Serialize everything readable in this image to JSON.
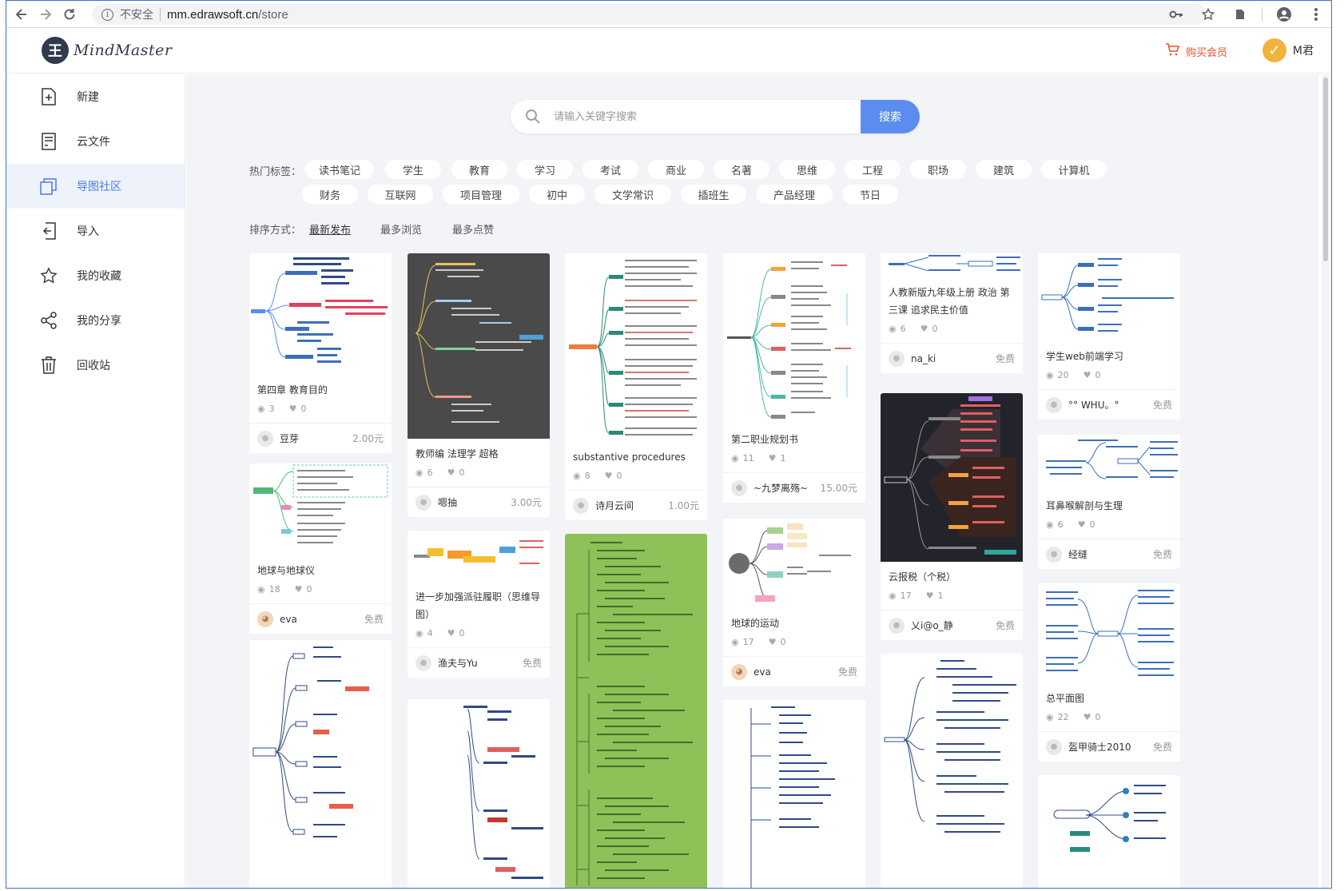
{
  "browser": {
    "security_label": "不安全",
    "url_host": "mm.edrawsoft.cn",
    "url_path": "/store"
  },
  "app": {
    "logo_letter": "王",
    "logo_text": "MindMaster",
    "buy_label": "购买会员",
    "user_name": "M君"
  },
  "sidebar": {
    "items": [
      {
        "label": "新建",
        "icon": "new-file-icon"
      },
      {
        "label": "云文件",
        "icon": "cloud-file-icon"
      },
      {
        "label": "导图社区",
        "icon": "community-icon"
      },
      {
        "label": "导入",
        "icon": "import-icon"
      },
      {
        "label": "我的收藏",
        "icon": "star-icon"
      },
      {
        "label": "我的分享",
        "icon": "share-icon"
      },
      {
        "label": "回收站",
        "icon": "trash-icon"
      }
    ]
  },
  "search": {
    "placeholder": "请输入关键字搜索",
    "button": "搜索"
  },
  "tags": {
    "label": "热门标签：",
    "row1": [
      "读书笔记",
      "学生",
      "教育",
      "学习",
      "考试",
      "商业",
      "名著",
      "思维",
      "工程",
      "职场",
      "建筑",
      "计算机"
    ],
    "row2": [
      "财务",
      "互联网",
      "项目管理",
      "初中",
      "文学常识",
      "插班生",
      "产品经理",
      "节日"
    ]
  },
  "sort": {
    "label": "排序方式：",
    "options": [
      "最新发布",
      "最多浏览",
      "最多点赞"
    ]
  },
  "cards": [
    {
      "title": "第四章 教育目的",
      "views": "3",
      "likes": "0",
      "author": "豆芽",
      "price": "2.00元"
    },
    {
      "title": "地球与地球仪",
      "views": "18",
      "likes": "0",
      "author": "eva",
      "price": "免费"
    },
    {
      "title": "教师编 法理学 超格",
      "views": "6",
      "likes": "0",
      "author": "嗯抽",
      "price": "3.00元"
    },
    {
      "title": "进一步加强派驻履职（思维导图）",
      "views": "4",
      "likes": "0",
      "author": "渔夫与Yu",
      "price": "免费"
    },
    {
      "title": "substantive procedures",
      "views": "8",
      "likes": "0",
      "author": "诗月云间",
      "price": "1.00元"
    },
    {
      "title": "第二职业规划书",
      "views": "11",
      "likes": "1",
      "author": "~九梦离殇~",
      "price": "15.00元"
    },
    {
      "title": "地球的运动",
      "views": "17",
      "likes": "0",
      "author": "eva",
      "price": "免费"
    },
    {
      "title": "人教新版九年级上册 政治 第三课 追求民主价值",
      "views": "6",
      "likes": "0",
      "author": "na_ki",
      "price": "免费"
    },
    {
      "title": "云报税（个税）",
      "views": "17",
      "likes": "1",
      "author": "乂i@o_静",
      "price": "免费"
    },
    {
      "title": "学生web前端学习",
      "views": "20",
      "likes": "0",
      "author": "°° WHU。°",
      "price": "免费"
    },
    {
      "title": "耳鼻喉解剖与生理",
      "views": "6",
      "likes": "0",
      "author": "经缝",
      "price": "免费"
    },
    {
      "title": "总平面图",
      "views": "22",
      "likes": "0",
      "author": "盔甲骑士2010",
      "price": "免费"
    }
  ],
  "colors": {
    "accent": "#5b8def",
    "buy": "#e8502c",
    "page_bg": "#f3f4f7",
    "dark_thumb": "#4a4a4a",
    "navy_thumb": "#23232b",
    "green_thumb": "#8fc158"
  }
}
